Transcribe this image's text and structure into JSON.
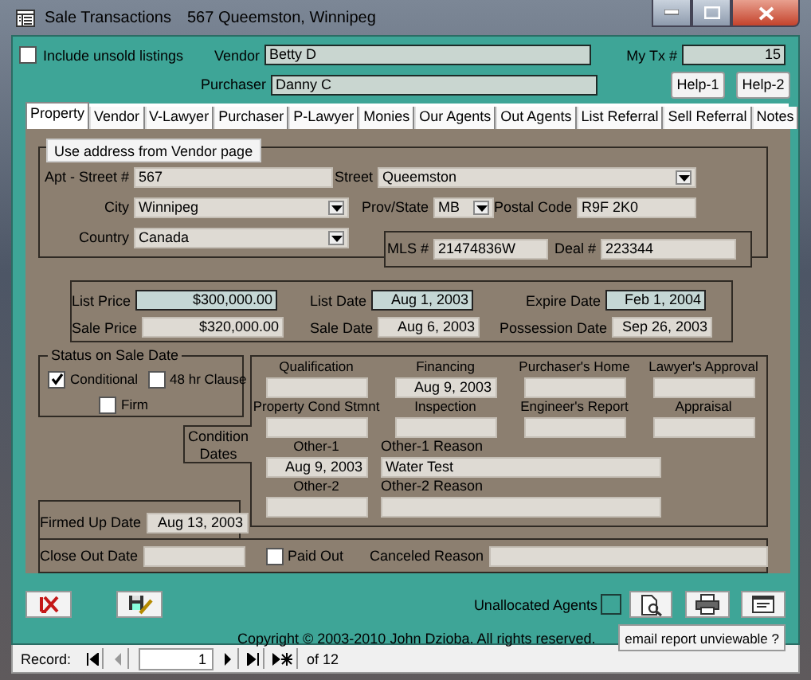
{
  "window": {
    "title": "Sale Transactions",
    "subtitle": "567 Queemston, Winnipeg"
  },
  "include_unsold": {
    "label": "Include unsold listings",
    "checked": false
  },
  "vendor": {
    "label": "Vendor",
    "value": "Betty D"
  },
  "purchaser": {
    "label": "Purchaser",
    "value": "Danny C"
  },
  "my_tx": {
    "label": "My Tx #",
    "value": "15"
  },
  "help_buttons": [
    "Help-1",
    "Help-2"
  ],
  "tabs": [
    {
      "label": "Property",
      "selected": true
    },
    {
      "label": "Vendor",
      "selected": false
    },
    {
      "label": "V-Lawyer",
      "selected": false
    },
    {
      "label": "Purchaser",
      "selected": false
    },
    {
      "label": "P-Lawyer",
      "selected": false
    },
    {
      "label": "Monies",
      "selected": false
    },
    {
      "label": "Our Agents",
      "selected": false
    },
    {
      "label": "Out Agents",
      "selected": false
    },
    {
      "label": "List Referral",
      "selected": false
    },
    {
      "label": "Sell Referral",
      "selected": false
    },
    {
      "label": "Notes",
      "selected": false
    }
  ],
  "address": {
    "button": "Use address from Vendor page",
    "apt": {
      "label": "Apt - Street #",
      "value": "567"
    },
    "street": {
      "label": "Street",
      "value": "Queemston",
      "kind": "dropdown"
    },
    "city": {
      "label": "City",
      "value": "Winnipeg",
      "kind": "dropdown"
    },
    "prov": {
      "label": "Prov/State",
      "value": "MB",
      "kind": "dropdown"
    },
    "postal": {
      "label": "Postal Code",
      "value": "R9F 2K0"
    },
    "country": {
      "label": "Country",
      "value": "Canada",
      "kind": "dropdown"
    }
  },
  "mls": {
    "label": "MLS #",
    "value": "21474836W"
  },
  "deal": {
    "label": "Deal #",
    "value": "223344"
  },
  "prices": [
    {
      "label": "List Price",
      "value": "$300,000.00",
      "kind": "outlined"
    },
    {
      "label": "List Date",
      "value": "Aug 1, 2003",
      "kind": "outlined"
    },
    {
      "label": "Expire Date",
      "value": "Feb 1, 2004",
      "kind": "outlined"
    },
    {
      "label": "Sale Price",
      "value": "$320,000.00",
      "kind": "text"
    },
    {
      "label": "Sale Date",
      "value": "Aug 6, 2003",
      "kind": "text"
    },
    {
      "label": "Possession Date",
      "value": "Sep 26, 2003",
      "kind": "text"
    }
  ],
  "status": {
    "title": "Status on Sale Date",
    "options": [
      {
        "label": "Conditional",
        "checked": true
      },
      {
        "label": "48 hr Clause",
        "checked": false
      },
      {
        "label": "Firm",
        "checked": false
      }
    ]
  },
  "conditions": {
    "tab": "Condition Dates",
    "items": [
      {
        "label": "Qualification"
      },
      {
        "label": "Financing",
        "value": "Aug 9, 2003"
      },
      {
        "label": "Purchaser's Home"
      },
      {
        "label": "Lawyer's Approval"
      },
      {
        "label": "Property Cond Stmnt"
      },
      {
        "label": "Inspection"
      },
      {
        "label": "Engineer's Report"
      },
      {
        "label": "Appraisal"
      }
    ],
    "others": [
      {
        "label": "Other-1",
        "value": "Aug 9, 2003",
        "reason_label": "Other-1 Reason",
        "reason": "Water Test"
      },
      {
        "label": "Other-2",
        "reason_label": "Other-2 Reason"
      }
    ]
  },
  "firmed_up": {
    "label": "Firmed Up Date",
    "value": "Aug 13, 2003"
  },
  "close_out": {
    "label": "Close Out Date"
  },
  "paid_out": {
    "label": "Paid Out",
    "checked": false
  },
  "canceled": {
    "label": "Canceled Reason"
  },
  "unallocated_agents": {
    "label": "Unallocated Agents",
    "checked": false
  },
  "copyright": "Copyright © 2003-2010 John Dzioba. All rights reserved.",
  "email_button": "email report unviewable ?",
  "record_nav": {
    "label": "Record:",
    "current": "1",
    "total": "of 12"
  }
}
